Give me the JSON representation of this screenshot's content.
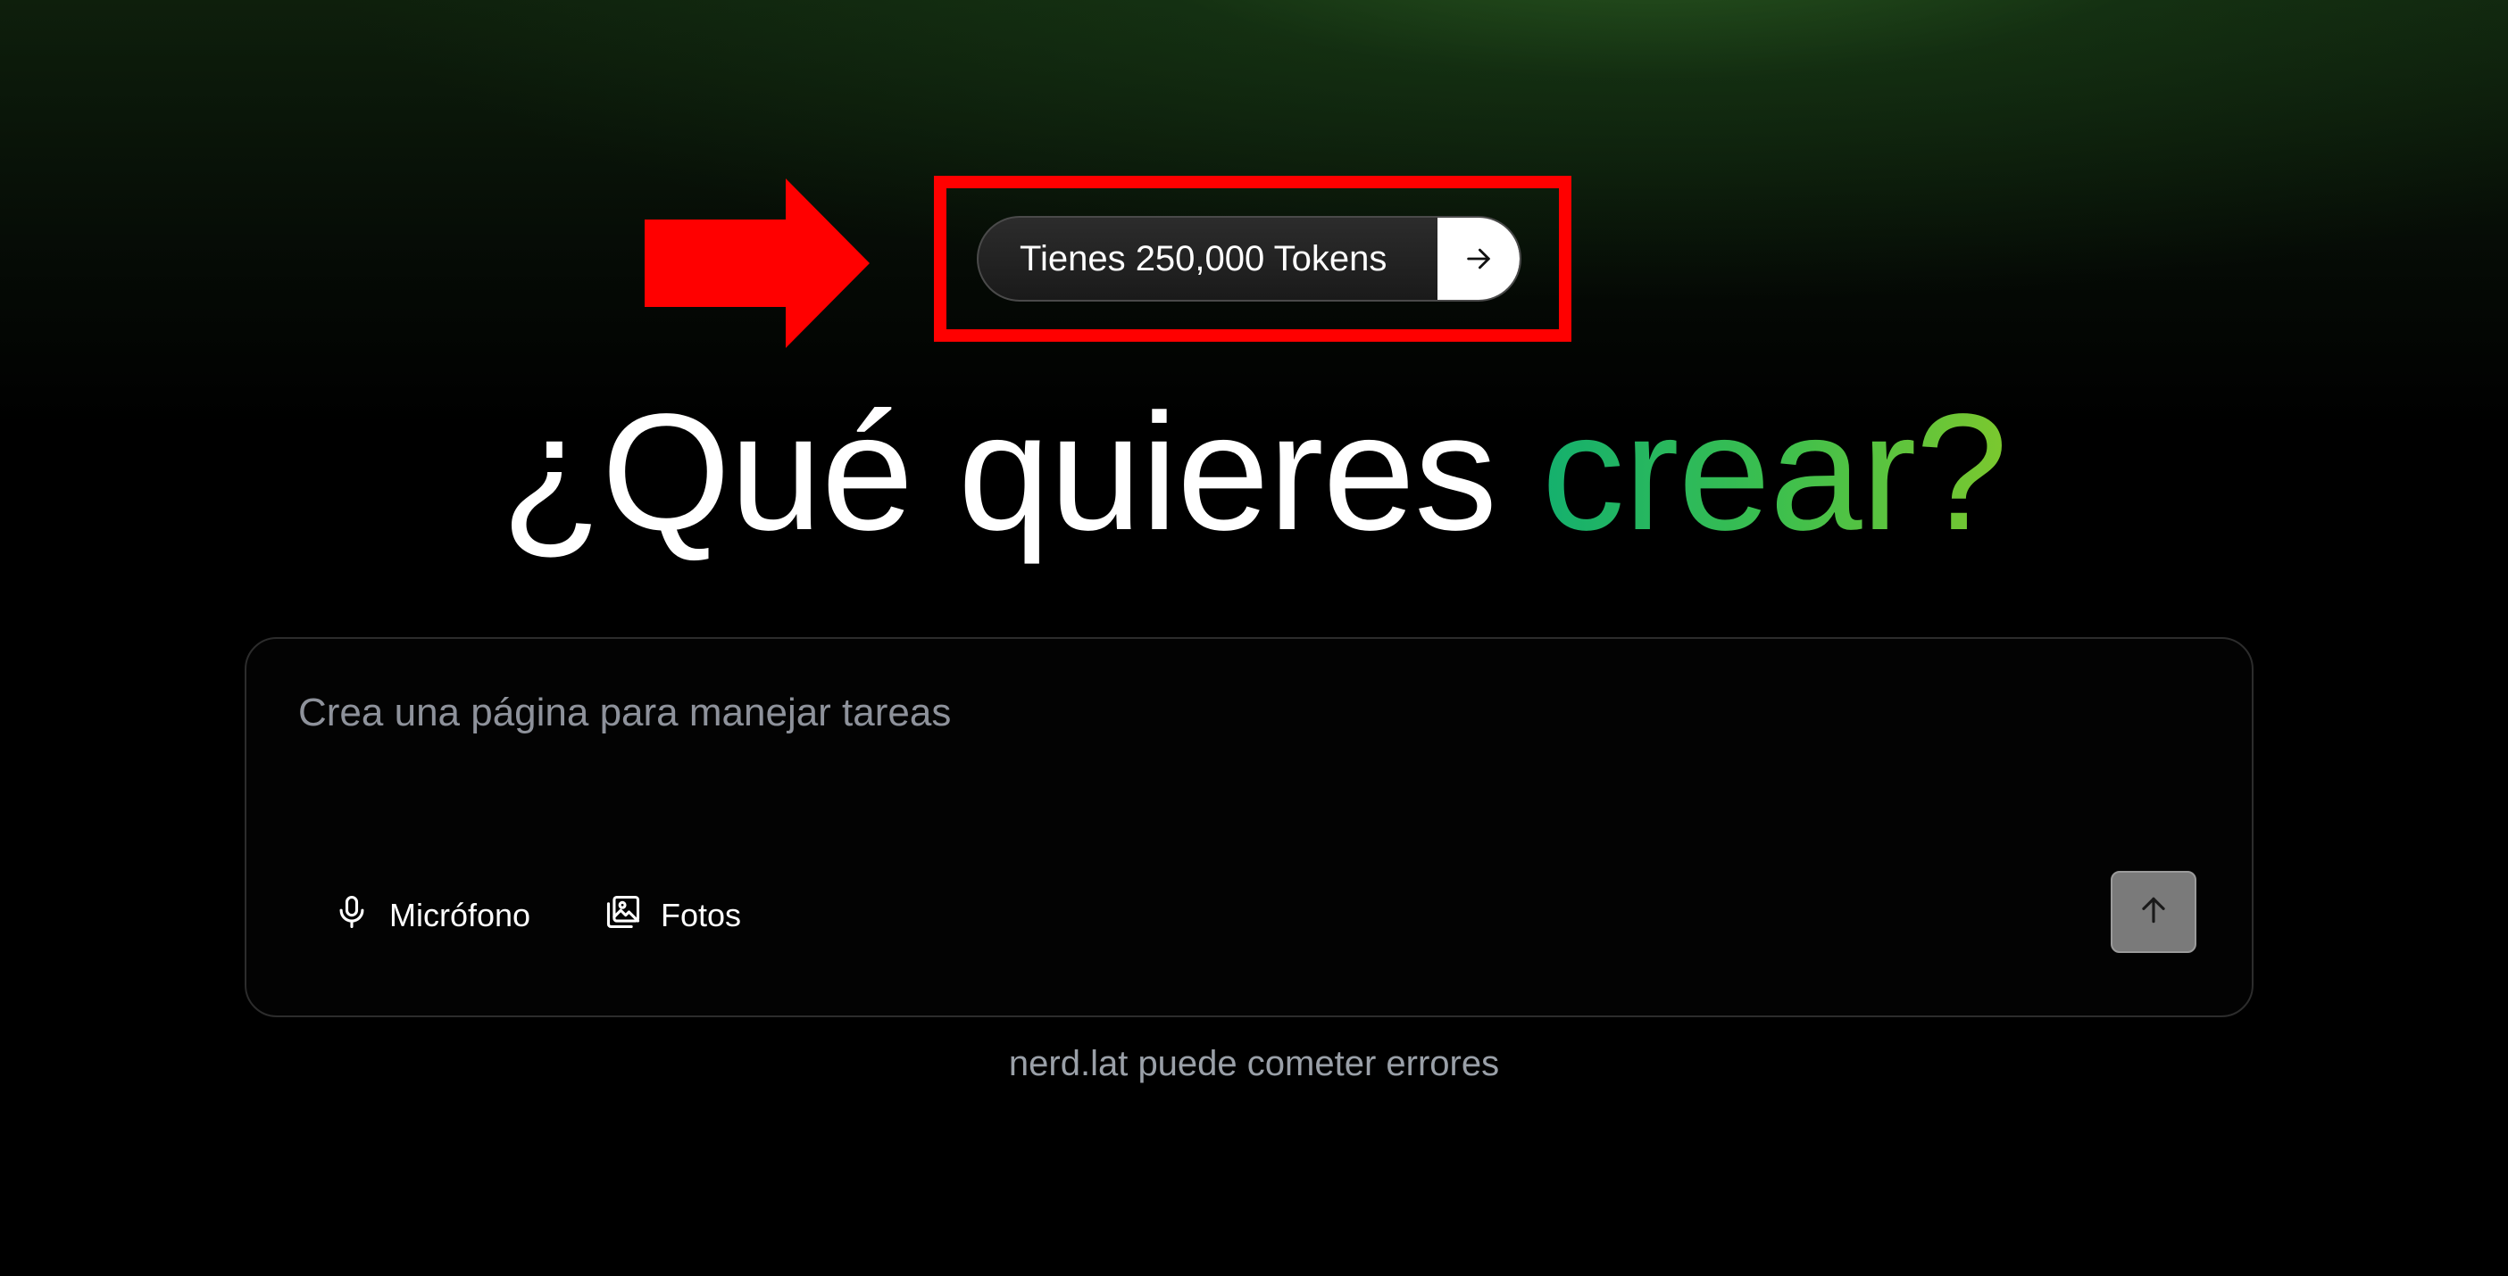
{
  "annotation": {
    "highlight_color": "#ff0000",
    "pointer_icon": "right-arrow-icon"
  },
  "token_banner": {
    "label": "Tienes 250,000 Tokens",
    "action_icon": "arrow-right-icon"
  },
  "hero": {
    "lead": "¿Qué quieres ",
    "accent": "crear?",
    "accent_gradient": [
      "#14b06e",
      "#7cc82e"
    ]
  },
  "composer": {
    "placeholder": "Crea una página para manejar tareas",
    "value": "",
    "tools": [
      {
        "label": "Micrófono",
        "icon": "microphone-icon"
      },
      {
        "label": "Fotos",
        "icon": "photos-icon"
      }
    ],
    "send_icon": "arrow-up-icon"
  },
  "footer": {
    "disclaimer": "nerd.lat puede cometer errores"
  }
}
